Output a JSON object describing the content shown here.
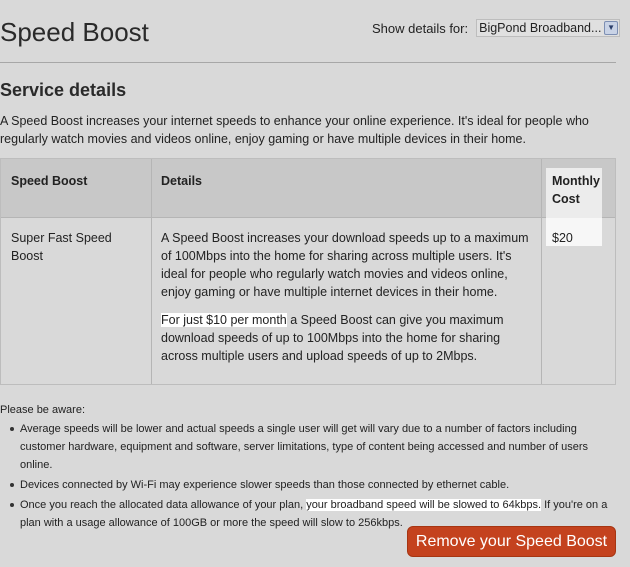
{
  "page": {
    "title": "Speed Boost"
  },
  "show_details": {
    "label": "Show details for:",
    "selected": "BigPond Broadband..."
  },
  "service": {
    "heading": "Service details",
    "intro": "A Speed Boost increases your internet speeds to enhance your online experience. It's ideal for people who regularly watch movies and videos online, enjoy gaming or have multiple devices in their home."
  },
  "table": {
    "headers": {
      "name": "Speed Boost",
      "details": "Details",
      "cost_line1": "Monthly",
      "cost_line2": "Cost"
    },
    "row": {
      "name": "Super Fast Speed Boost",
      "details_p1": "A Speed Boost increases your download speeds up to a maximum of 100Mbps into the home for sharing across multiple users. It's ideal for people who regularly watch movies and videos online, enjoy gaming or have multiple internet devices in their home.",
      "details_p2_highlight": "For just $10 per month",
      "details_p2_rest": " a Speed Boost can give you maximum download speeds of up to 100Mbps into the home for sharing across multiple users and upload speeds of up to 2Mbps.",
      "cost": "$20"
    }
  },
  "aware": {
    "heading": "Please be aware:",
    "bullet1": "Average speeds will be lower and actual speeds a single user will get will vary due to a number of factors including customer hardware, equipment and software, server limitations, type of content being accessed and number of users online.",
    "bullet2": "Devices connected by Wi-Fi may experience slower speeds than those connected by ethernet cable.",
    "bullet3_pre": "Once you reach the allocated data allowance of your plan, ",
    "bullet3_highlight": "your broadband speed will be slowed to 64kbps.",
    "bullet3_post": " If you're on a plan with a usage allowance of 100GB or more the speed will slow to 256kbps."
  },
  "actions": {
    "remove_label": "Remove your Speed Boost"
  },
  "colors": {
    "accent": "#c4421e",
    "background": "#d9d9d9"
  }
}
